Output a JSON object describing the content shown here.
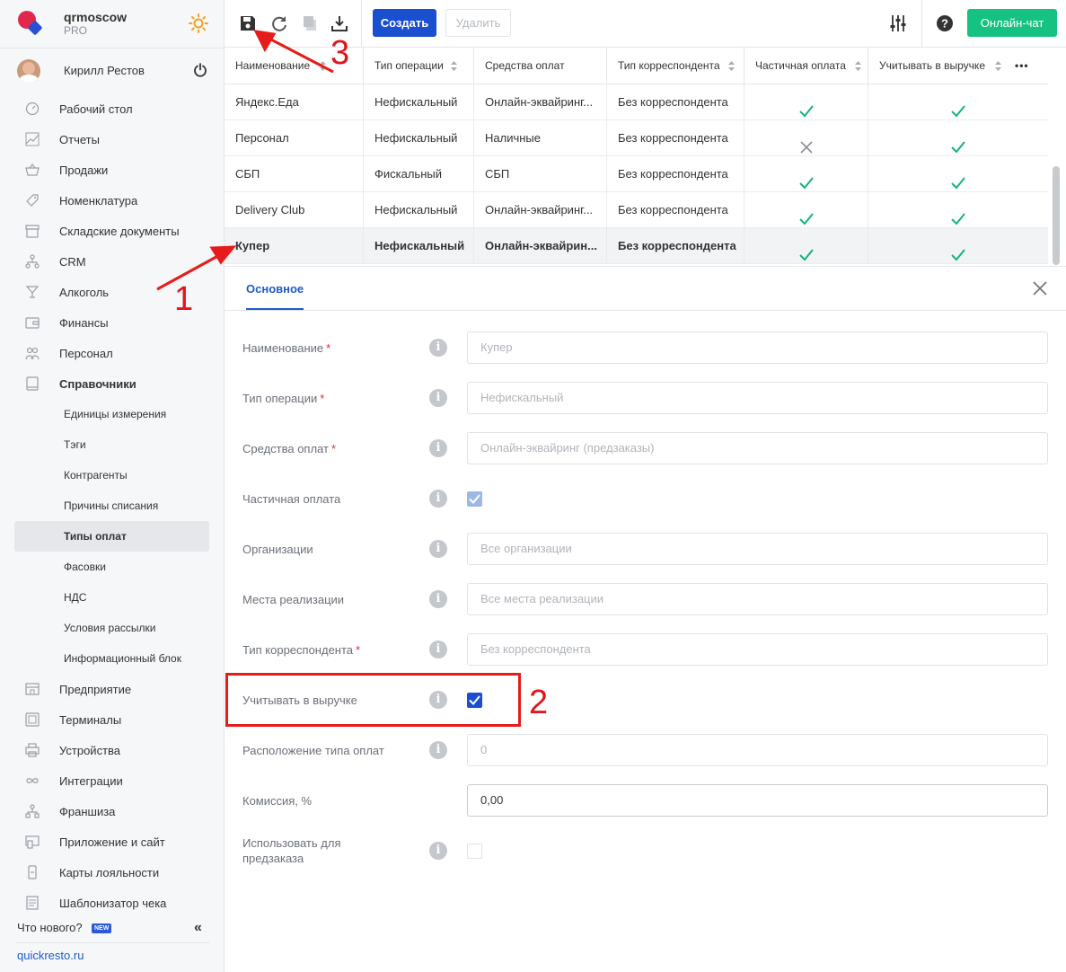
{
  "brand": {
    "name": "qrmoscow",
    "plan": "PRO"
  },
  "user": {
    "name": "Кирилл Рестов"
  },
  "nav": [
    {
      "label": "Рабочий стол",
      "icon": "dashboard-icon"
    },
    {
      "label": "Отчеты",
      "icon": "reports-icon"
    },
    {
      "label": "Продажи",
      "icon": "basket-icon"
    },
    {
      "label": "Номенклатура",
      "icon": "tag-icon"
    },
    {
      "label": "Складские документы",
      "icon": "warehouse-icon"
    },
    {
      "label": "CRM",
      "icon": "crm-icon"
    },
    {
      "label": "Алкоголь",
      "icon": "cocktail-icon"
    },
    {
      "label": "Финансы",
      "icon": "wallet-icon"
    },
    {
      "label": "Персонал",
      "icon": "staff-icon"
    },
    {
      "label": "Справочники",
      "icon": "book-icon"
    }
  ],
  "subnav": [
    "Единицы измерения",
    "Тэги",
    "Контрагенты",
    "Причины списания",
    "Типы оплат",
    "Фасовки",
    "НДС",
    "Условия рассылки",
    "Информационный блок"
  ],
  "nav2": [
    {
      "label": "Предприятие",
      "icon": "store-icon"
    },
    {
      "label": "Терминалы",
      "icon": "terminal-icon"
    },
    {
      "label": "Устройства",
      "icon": "printer-icon"
    },
    {
      "label": "Интеграции",
      "icon": "infinity-icon"
    },
    {
      "label": "Франшиза",
      "icon": "franchise-icon"
    },
    {
      "label": "Приложение и сайт",
      "icon": "app-icon"
    },
    {
      "label": "Карты лояльности",
      "icon": "loyalty-card-icon"
    },
    {
      "label": "Шаблонизатор чека",
      "icon": "receipt-icon"
    }
  ],
  "footer": {
    "whats_new": "Что нового?",
    "badge": "NEW",
    "collapse": "«",
    "site": "quickresto.ru"
  },
  "toolbar": {
    "create": "Создать",
    "delete": "Удалить",
    "chat": "Онлайн-чат"
  },
  "table": {
    "columns": [
      "Наименование",
      "Тип операции",
      "Средства оплат",
      "Тип корреспондента",
      "Частичная оплата",
      "Учитывать в выручке"
    ],
    "more": "•••",
    "rows": [
      {
        "name": "Яндекс.Еда",
        "op": "Нефискальный",
        "means": "Онлайн-эквайринг...",
        "corr": "Без корреспондента",
        "partial": true,
        "revenue": true
      },
      {
        "name": "Персонал",
        "op": "Нефискальный",
        "means": "Наличные",
        "corr": "Без корреспондента",
        "partial": false,
        "revenue": true
      },
      {
        "name": "СБП",
        "op": "Фискальный",
        "means": "СБП",
        "corr": "Без корреспондента",
        "partial": true,
        "revenue": true
      },
      {
        "name": "Delivery Club",
        "op": "Нефискальный",
        "means": "Онлайн-эквайринг...",
        "corr": "Без корреспондента",
        "partial": true,
        "revenue": true
      },
      {
        "name": "Купер",
        "op": "Нефискальный",
        "means": "Онлайн-эквайрин...",
        "corr": "Без корреспондента",
        "partial": true,
        "revenue": true
      }
    ]
  },
  "form": {
    "tab": "Основное",
    "fields": [
      {
        "label": "Наименование",
        "required": "*",
        "placeholder": "Купер",
        "kind": "input"
      },
      {
        "label": "Тип операции",
        "required": "*",
        "placeholder": "Нефискальный",
        "kind": "input"
      },
      {
        "label": "Средства оплат",
        "required": "*",
        "placeholder": "Онлайн-эквайринг (предзаказы)",
        "kind": "input"
      },
      {
        "label": "Частичная оплата",
        "required": "",
        "kind": "checkbox-disabled"
      },
      {
        "label": "Организации",
        "required": "",
        "placeholder": "Все организации",
        "kind": "input"
      },
      {
        "label": "Места реализации",
        "required": "",
        "placeholder": "Все места реализации",
        "kind": "input"
      },
      {
        "label": "Тип корреспондента",
        "required": "*",
        "placeholder": "Без корреспондента",
        "kind": "input"
      },
      {
        "label": "Учитывать в выручке",
        "required": "",
        "kind": "checkbox-on"
      },
      {
        "label": "Расположение типа оплат",
        "required": "",
        "placeholder": "0",
        "kind": "input"
      },
      {
        "label": "Комиссия, %",
        "required": "",
        "value": "0,00",
        "kind": "input-active"
      },
      {
        "label": "Использовать для предзаказа",
        "required": "",
        "kind": "checkbox-off"
      }
    ]
  },
  "annotations": {
    "a1": "1",
    "a2": "2",
    "a3": "3"
  },
  "colors": {
    "primary": "#1a4fcf",
    "chat": "#16c282",
    "check": "#16b27a",
    "annotation": "#e61c1c"
  }
}
